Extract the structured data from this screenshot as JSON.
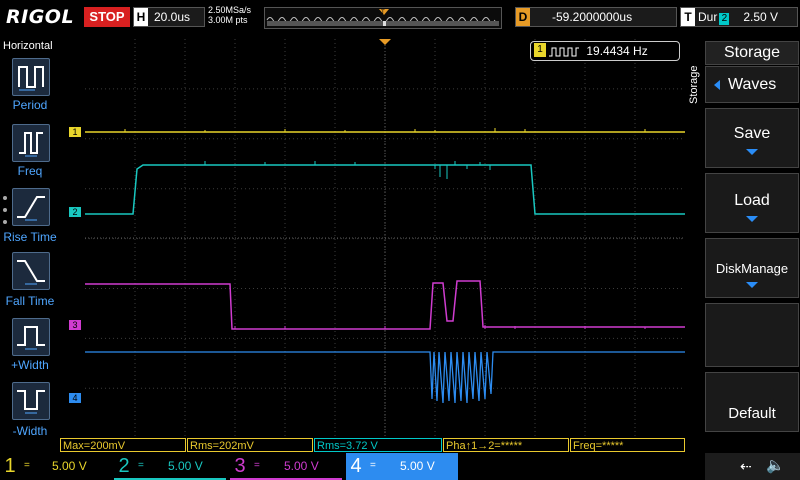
{
  "header": {
    "brand": "RIGOL",
    "run_state": "STOP",
    "timebase_key": "H",
    "timebase": "20.0us",
    "sample_rate": "2.50MSa/s",
    "mem_depth": "3.00M pts",
    "delay_key": "D",
    "delay": "-59.2000000us",
    "trigger_key": "T",
    "trigger_type": "Dur",
    "trigger_source": "2",
    "trigger_level": "2.50 V"
  },
  "left_menu": {
    "title": "Horizontal",
    "items": [
      {
        "label": "Period",
        "icon": "period-icon"
      },
      {
        "label": "Freq",
        "icon": "freq-icon"
      },
      {
        "label": "Rise Time",
        "icon": "rise-time-icon"
      },
      {
        "label": "Fall Time",
        "icon": "fall-time-icon"
      },
      {
        "label": "+Width",
        "icon": "positive-width-icon"
      },
      {
        "label": "-Width",
        "icon": "negative-width-icon"
      }
    ]
  },
  "freq_counter": {
    "channel": "1",
    "value": "19.4434 Hz"
  },
  "right_menu": {
    "side_label": "Storage",
    "title": "Storage",
    "items": [
      {
        "label": "Waves"
      },
      {
        "label": "Save"
      },
      {
        "label": "Load"
      },
      {
        "label": "DiskManage"
      },
      {
        "label": "Default"
      }
    ]
  },
  "measurements": [
    {
      "text": "Max=200mV"
    },
    {
      "text": "Rms=202mV"
    },
    {
      "text": "Rms=3.72 V"
    },
    {
      "text": "Pha↑1→2=*****"
    },
    {
      "text": "Freq=*****"
    }
  ],
  "channels": [
    {
      "num": "1",
      "coupling": "=",
      "scale": "5.00 V",
      "color": "#e9d62b"
    },
    {
      "num": "2",
      "coupling": "=",
      "scale": "5.00 V",
      "color": "#19c7c0"
    },
    {
      "num": "3",
      "coupling": "=",
      "scale": "5.00 V",
      "color": "#d03cd0"
    },
    {
      "num": "4",
      "coupling": "=",
      "scale": "5.00 V",
      "color": "#2d8cf0"
    }
  ],
  "trace_markers": {
    "ch1": "1",
    "ch2": "2",
    "ch3": "3",
    "ch4": "4",
    "trigger": "T"
  },
  "colors": {
    "accent": "#2a8df7",
    "trigger": "#e79b26",
    "stop": "#d82020"
  }
}
